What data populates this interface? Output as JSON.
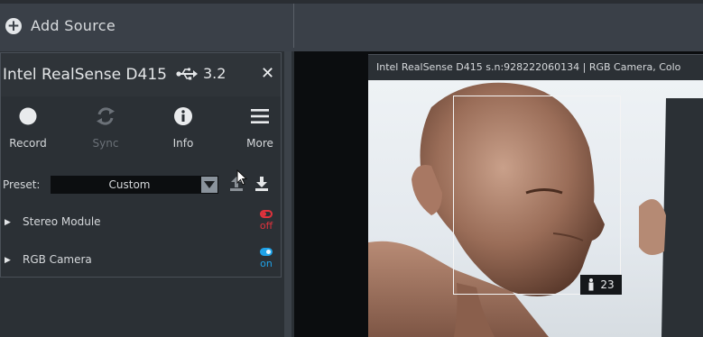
{
  "top_bar": {
    "add_source_label": "Add Source"
  },
  "device_panel": {
    "device_name": "Intel RealSense D415",
    "usb_version": "3.2",
    "close_icon": "close-icon",
    "toolbar": [
      {
        "label": "Record",
        "icon": "record-icon",
        "enabled": true
      },
      {
        "label": "Sync",
        "icon": "sync-icon",
        "enabled": false
      },
      {
        "label": "Info",
        "icon": "info-icon",
        "enabled": true
      },
      {
        "label": "More",
        "icon": "menu-icon",
        "enabled": true
      }
    ],
    "preset": {
      "label": "Preset:",
      "value": "Custom"
    },
    "modules": [
      {
        "name": "Stereo Module",
        "state": "off",
        "color": "#e0323c"
      },
      {
        "name": "RGB Camera",
        "state": "on",
        "color": "#1fa2e8"
      }
    ]
  },
  "stream_view": {
    "title": "Intel RealSense D415 s.n:928222060134 | RGB Camera, Colo",
    "face_count": "23"
  },
  "colors": {
    "off_red": "#e0323c",
    "on_blue": "#1fa2e8",
    "panel_bg": "#2b3035",
    "top_bar_bg": "#3a4048"
  }
}
